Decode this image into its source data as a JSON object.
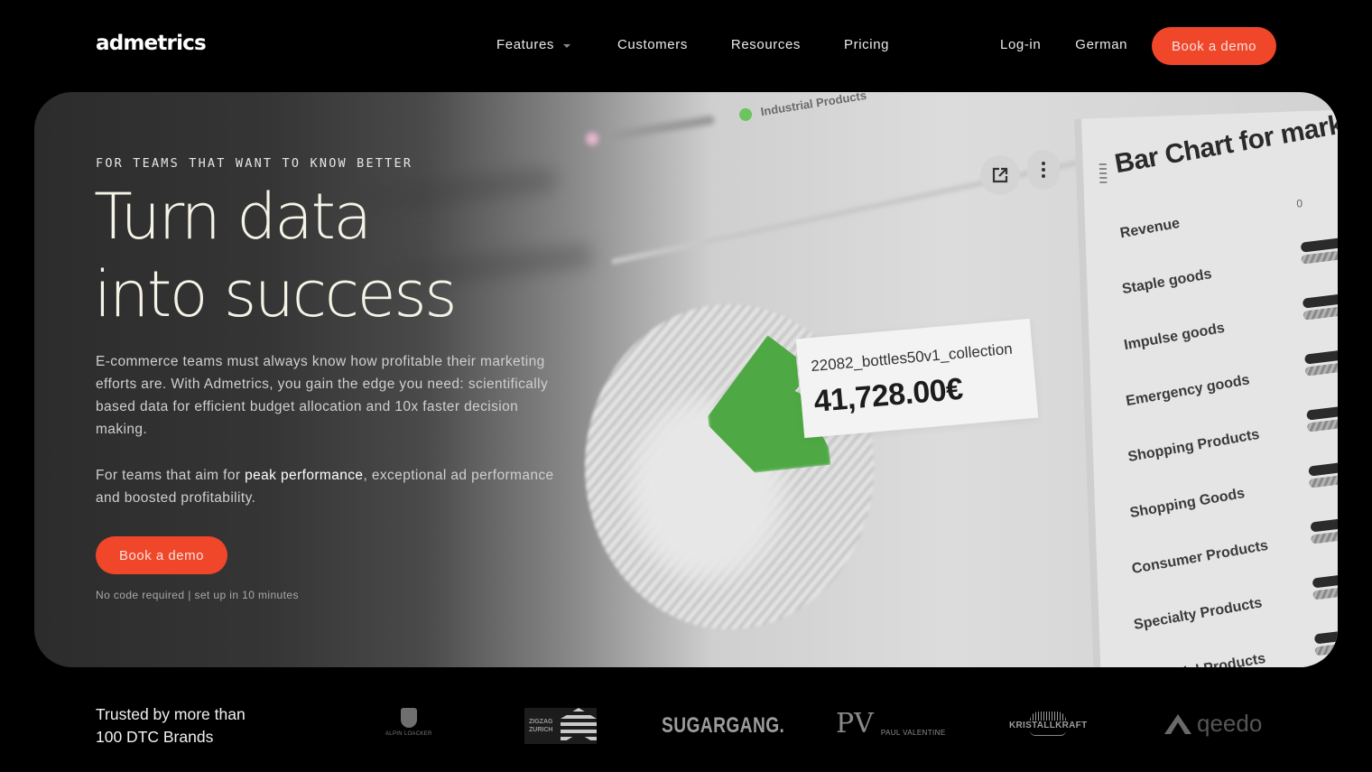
{
  "nav": {
    "logo": "admetrics",
    "links": [
      {
        "label": "Features",
        "has_dropdown": true
      },
      {
        "label": "Customers"
      },
      {
        "label": "Resources"
      },
      {
        "label": "Pricing"
      }
    ],
    "login": "Log-in",
    "language": "German",
    "cta": "Book a demo"
  },
  "hero": {
    "eyebrow": "FOR TEAMS THAT WANT TO KNOW BETTER",
    "headline_line1": "Turn data",
    "headline_line2": "into success",
    "paragraph": "E-commerce teams must always know how profitable their marketing efforts are. With Admetrics, you gain the edge you need: scientifically based data for efficient budget allocation and 10x faster decision making.",
    "paragraph2_prefix": "For teams that aim for ",
    "paragraph2_highlight": "peak performance",
    "paragraph2_suffix": ", exceptional ad performance and boosted profitability.",
    "cta": "Book a demo",
    "note": "No code required | set up in 10 minutes"
  },
  "dashboard_image": {
    "legend_item": "Industrial Products",
    "legend_color": "#6cc45f",
    "tooltip_label": "22082_bottles50v1_collection",
    "tooltip_value": "41,728.00€",
    "slice_color": "#4ea944",
    "bar_chart_title": "Bar Chart for mark",
    "axis_zero": "0",
    "categories": [
      "Revenue",
      "Staple goods",
      "Impulse goods",
      "Emergency goods",
      "Shopping Products",
      "Shopping Goods",
      "Consumer Products",
      "Specialty Products",
      "Industrial Products"
    ]
  },
  "trust": {
    "line1": "Trusted by more than",
    "line2": "100 DTC Brands",
    "brands": {
      "alpin": "ALPIN LOACKER",
      "zigzag1": "ZIGZAG",
      "zigzag2": "ZURICH",
      "sugar": "SUGARGANG.",
      "paul_mark": "PV",
      "paul": "PAUL VALENTINE",
      "kristall": "KRISTALLKRAFT",
      "qeedo": "qeedo"
    }
  },
  "colors": {
    "accent": "#f0462a",
    "background": "#000000",
    "headline": "#f5f3e6"
  }
}
